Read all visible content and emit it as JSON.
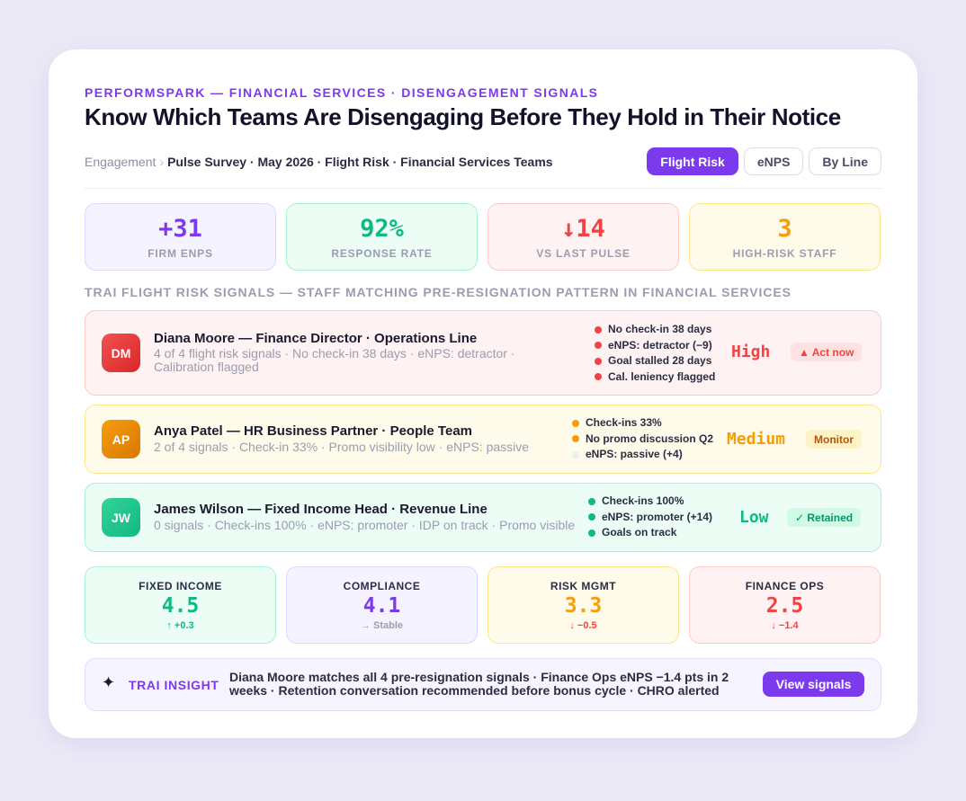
{
  "header": {
    "eyebrow": "PERFORMSPARK — FINANCIAL SERVICES · DISENGAGEMENT SIGNALS",
    "title": "Know Which Teams Are Disengaging Before They Hold in Their Notice"
  },
  "breadcrumb": {
    "root": "Engagement",
    "separator": "›",
    "current": "Pulse Survey · May 2026 · Flight Risk · Financial Services Teams"
  },
  "tabs": [
    {
      "label": "Flight Risk",
      "active": true
    },
    {
      "label": "eNPS",
      "active": false
    },
    {
      "label": "By Line",
      "active": false
    }
  ],
  "stats": [
    {
      "value": "+31",
      "label": "FIRM ENPS"
    },
    {
      "value": "92%",
      "label": "RESPONSE RATE"
    },
    {
      "value": "↓14",
      "label": "VS LAST PULSE"
    },
    {
      "value": "3",
      "label": "HIGH-RISK STAFF"
    }
  ],
  "section_label": "TRAI FLIGHT RISK SIGNALS — STAFF MATCHING PRE-RESIGNATION PATTERN IN FINANCIAL SERVICES",
  "people": [
    {
      "initials": "DM",
      "name": "Diana Moore — Finance Director · Operations Line",
      "description": "4 of 4 flight risk signals · No check-in 38 days · eNPS: detractor · Calibration flagged",
      "signals": [
        "No check-in 38 days",
        "eNPS: detractor (−9)",
        "Goal stalled 28 days",
        "Cal. leniency flagged"
      ],
      "signal_colors": [
        "#ef4444",
        "#ef4444",
        "#ef4444",
        "#ef4444"
      ],
      "level": "High",
      "action": "▲ Act now"
    },
    {
      "initials": "AP",
      "name": "Anya Patel — HR Business Partner · People Team",
      "description": "2 of 4 signals · Check-in 33% · Promo visibility low · eNPS: passive",
      "signals": [
        "Check-ins 33%",
        "No promo discussion Q2",
        "eNPS: passive (+4)"
      ],
      "signal_colors": [
        "#f59e0b",
        "#f59e0b",
        "#e6f4ef"
      ],
      "level": "Medium",
      "action": "Monitor"
    },
    {
      "initials": "JW",
      "name": "James Wilson — Fixed Income Head · Revenue Line",
      "description": "0 signals · Check-ins 100% · eNPS: promoter · IDP on track · Promo visible",
      "signals": [
        "Check-ins 100%",
        "eNPS: promoter (+14)",
        "Goals on track"
      ],
      "signal_colors": [
        "#10b981",
        "#10b981",
        "#10b981"
      ],
      "level": "Low",
      "action": "✓ Retained"
    }
  ],
  "lines": [
    {
      "name": "FIXED INCOME",
      "score": "4.5",
      "delta": "↑ +0.3"
    },
    {
      "name": "COMPLIANCE",
      "score": "4.1",
      "delta": "→ Stable"
    },
    {
      "name": "RISK MGMT",
      "score": "3.3",
      "delta": "↓ −0.5"
    },
    {
      "name": "FINANCE OPS",
      "score": "2.5",
      "delta": "↓ −1.4"
    }
  ],
  "insight": {
    "icon": "sparkle-icon",
    "label": "TRAI INSIGHT",
    "text": "Diana Moore matches all 4 pre-resignation signals · Finance Ops eNPS −1.4 pts in 2 weeks · Retention conversation recommended before bonus cycle · CHRO alerted",
    "button": "View signals"
  },
  "colors": {
    "accent": "#7c3aed",
    "high": "#ef4444",
    "medium": "#f59e0b",
    "low": "#10b981"
  }
}
